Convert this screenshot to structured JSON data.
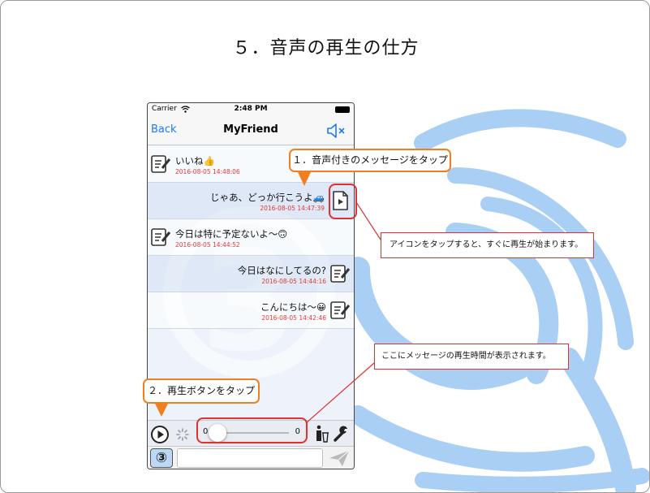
{
  "slide": {
    "title": "５．音声の再生の仕方",
    "accent_color": "#f07f22",
    "highlight_color": "#e03030",
    "decor_color": "#9fc9f2"
  },
  "statusbar": {
    "carrier": "Carrier",
    "time": "2:48 PM",
    "icons": [
      "wifi-icon",
      "battery-icon"
    ]
  },
  "navbar": {
    "back_label": "Back",
    "title": "MyFriend",
    "mute_icon": "speaker-mute-icon"
  },
  "messages": [
    {
      "text": "いいね👍",
      "timestamp": "2016-08-05 14:48:06",
      "side": "left",
      "icon": "memo-icon"
    },
    {
      "text": "じゃあ、どっか行こうよ🚙",
      "timestamp": "2016-08-05 14:47:39",
      "side": "right",
      "icon": "audio-file-play-icon"
    },
    {
      "text": "今日は特に予定ないよ〜🙃",
      "timestamp": "2016-08-05 14:44:52",
      "side": "left",
      "icon": "memo-icon"
    },
    {
      "text": "今日はなにしてるの?",
      "timestamp": "2016-08-05 14:44:16",
      "side": "right",
      "icon": "memo-icon"
    },
    {
      "text": "こんにちは〜😀",
      "timestamp": "2016-08-05 14:42:46",
      "side": "right",
      "icon": "memo-icon"
    }
  ],
  "player": {
    "elapsed": "0",
    "duration": "0",
    "progress_fraction": 0,
    "icons": [
      "play-icon",
      "loading-spinner-icon",
      "trash-icon",
      "wrench-icon"
    ]
  },
  "input_bar": {
    "avatar_label": "③",
    "message_value": "",
    "send_icon": "send-icon"
  },
  "callouts": {
    "step1": "１．音声付きのメッセージをタップ",
    "step2": "２．再生ボタンをタップ",
    "note_icon": "アイコンをタップすると、すぐに再生が始まります。",
    "note_time": "ここにメッセージの再生時間が表示されます。"
  }
}
